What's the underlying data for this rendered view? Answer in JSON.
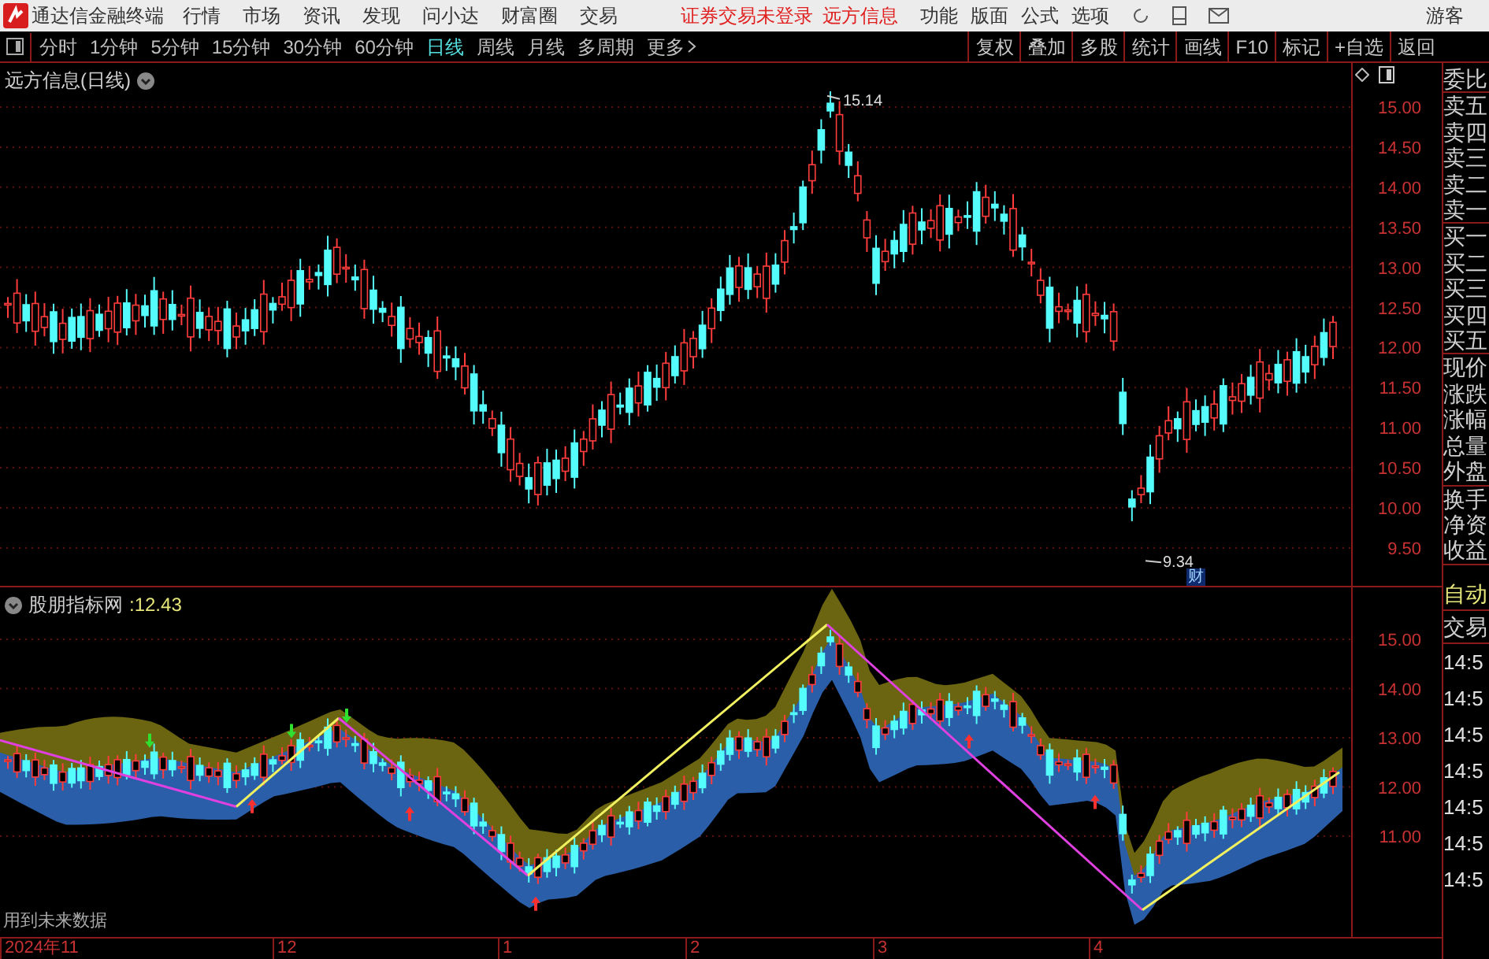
{
  "app": {
    "title": "通达信金融终端",
    "menu": [
      "行情",
      "市场",
      "资讯",
      "发现",
      "问小达",
      "财富圈",
      "交易"
    ],
    "notices": [
      "证券交易未登录",
      "远方信息"
    ],
    "right_menu": [
      "功能",
      "版面",
      "公式",
      "选项"
    ],
    "user": "游客"
  },
  "periods": [
    {
      "label": "分时",
      "selected": false
    },
    {
      "label": "1分钟",
      "selected": false
    },
    {
      "label": "5分钟",
      "selected": false
    },
    {
      "label": "15分钟",
      "selected": false
    },
    {
      "label": "30分钟",
      "selected": false
    },
    {
      "label": "60分钟",
      "selected": false
    },
    {
      "label": "日线",
      "selected": true
    },
    {
      "label": "周线",
      "selected": false
    },
    {
      "label": "月线",
      "selected": false
    },
    {
      "label": "多周期",
      "selected": false
    },
    {
      "label": "更多",
      "selected": false
    }
  ],
  "tools": [
    "复权",
    "叠加",
    "多股",
    "统计",
    "画线",
    "F10",
    "标记",
    "+自选",
    "返回"
  ],
  "main_chart": {
    "title": "远方信息(日线)",
    "y_ticks": [
      "15.00",
      "14.50",
      "14.00",
      "13.50",
      "13.00",
      "12.50",
      "12.00",
      "11.50",
      "11.00",
      "10.50",
      "10.00",
      "9.50"
    ],
    "high_label": "15.14",
    "low_label": "9.34",
    "marker": "财"
  },
  "indicator": {
    "name": "股朋指标网",
    "value": ":12.43",
    "y_ticks": [
      "15.00",
      "14.00",
      "13.00",
      "12.00",
      "11.00"
    ],
    "note": "用到未来数据"
  },
  "x_axis": [
    "2024年11",
    "12",
    "1",
    "2",
    "3",
    "4"
  ],
  "quote_panel": {
    "groups": [
      [
        "委比"
      ],
      [
        "卖五",
        "卖四",
        "卖三",
        "卖二",
        "卖一"
      ],
      [
        "买一",
        "买二",
        "买三",
        "买四",
        "买五"
      ],
      [
        "现价",
        "涨跌",
        "涨幅",
        "总量",
        "外盘"
      ],
      [
        "换手",
        "净资",
        "收益"
      ]
    ],
    "auto_label": "自动",
    "trade_label": "交易",
    "times": [
      "14:5",
      "14:5",
      "14:5",
      "14:5",
      "14:5",
      "14:5",
      "14:5"
    ]
  }
}
